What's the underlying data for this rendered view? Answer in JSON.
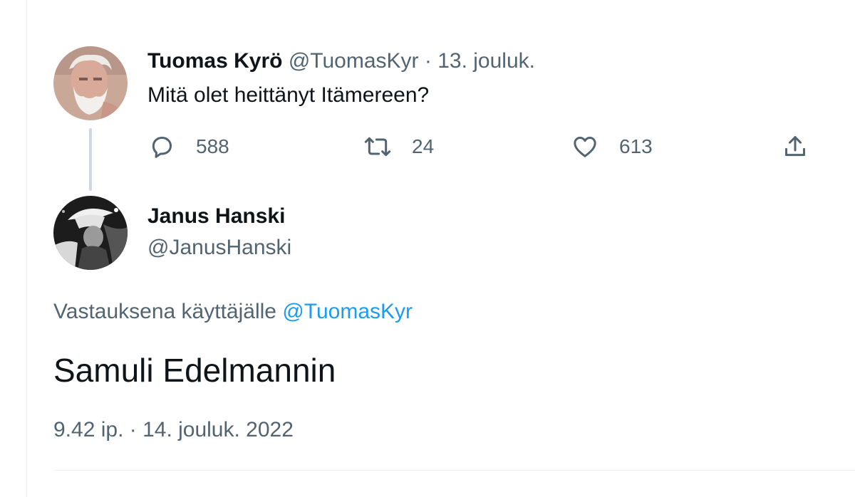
{
  "parent_tweet": {
    "author_name": "Tuomas Kyrö",
    "author_handle": "@TuomasKyr",
    "separator": " · ",
    "date": "13. jouluk.",
    "text": "Mitä olet heittänyt Itämereen?",
    "reply_count": "588",
    "retweet_count": "24",
    "like_count": "613"
  },
  "reply_tweet": {
    "author_name": "Janus Hanski",
    "author_handle": "@JanusHanski",
    "replying_to_prefix": "Vastauksena käyttäjälle ",
    "replying_to_handle": "@TuomasKyr",
    "text": "Samuli Edelmannin",
    "timestamp": "9.42 ip. · 14. jouluk. 2022"
  },
  "icons": {
    "reply": "speech-bubble-icon",
    "retweet": "retweet-icon",
    "like": "heart-icon",
    "share": "share-upload-icon"
  },
  "colors": {
    "text": "#0f1419",
    "muted": "#536471",
    "link": "#1d9bf0",
    "thread_line": "#cfd9de"
  }
}
